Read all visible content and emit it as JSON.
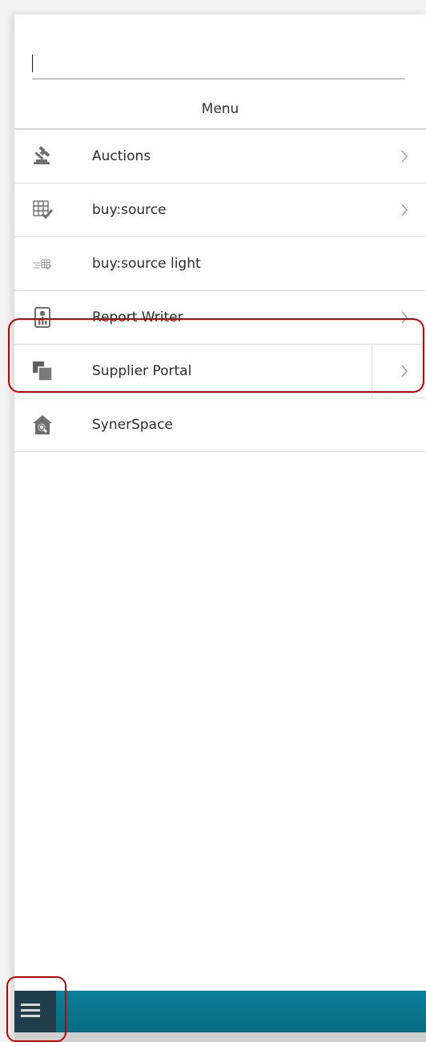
{
  "search": {
    "value": "",
    "placeholder": ""
  },
  "menu": {
    "title": "Menu",
    "items": [
      {
        "label": "Auctions",
        "icon": "gavel-icon",
        "has_submenu": true
      },
      {
        "label": "buy:source",
        "icon": "grid-check-icon",
        "has_submenu": true
      },
      {
        "label": "buy:source light",
        "icon": "list-grid-icon",
        "has_submenu": false
      },
      {
        "label": "Report Writer",
        "icon": "report-icon",
        "has_submenu": true
      },
      {
        "label": "Supplier Portal",
        "icon": "stacked-squares-icon",
        "has_submenu": true,
        "selected": true
      },
      {
        "label": "SynerSpace",
        "icon": "house-search-icon",
        "has_submenu": false
      }
    ]
  },
  "footer": {
    "toggle_icon": "hamburger-icon"
  },
  "colors": {
    "accent": "#0a7891",
    "highlight": "#c00000",
    "icon_gray": "#6f6f6f"
  }
}
